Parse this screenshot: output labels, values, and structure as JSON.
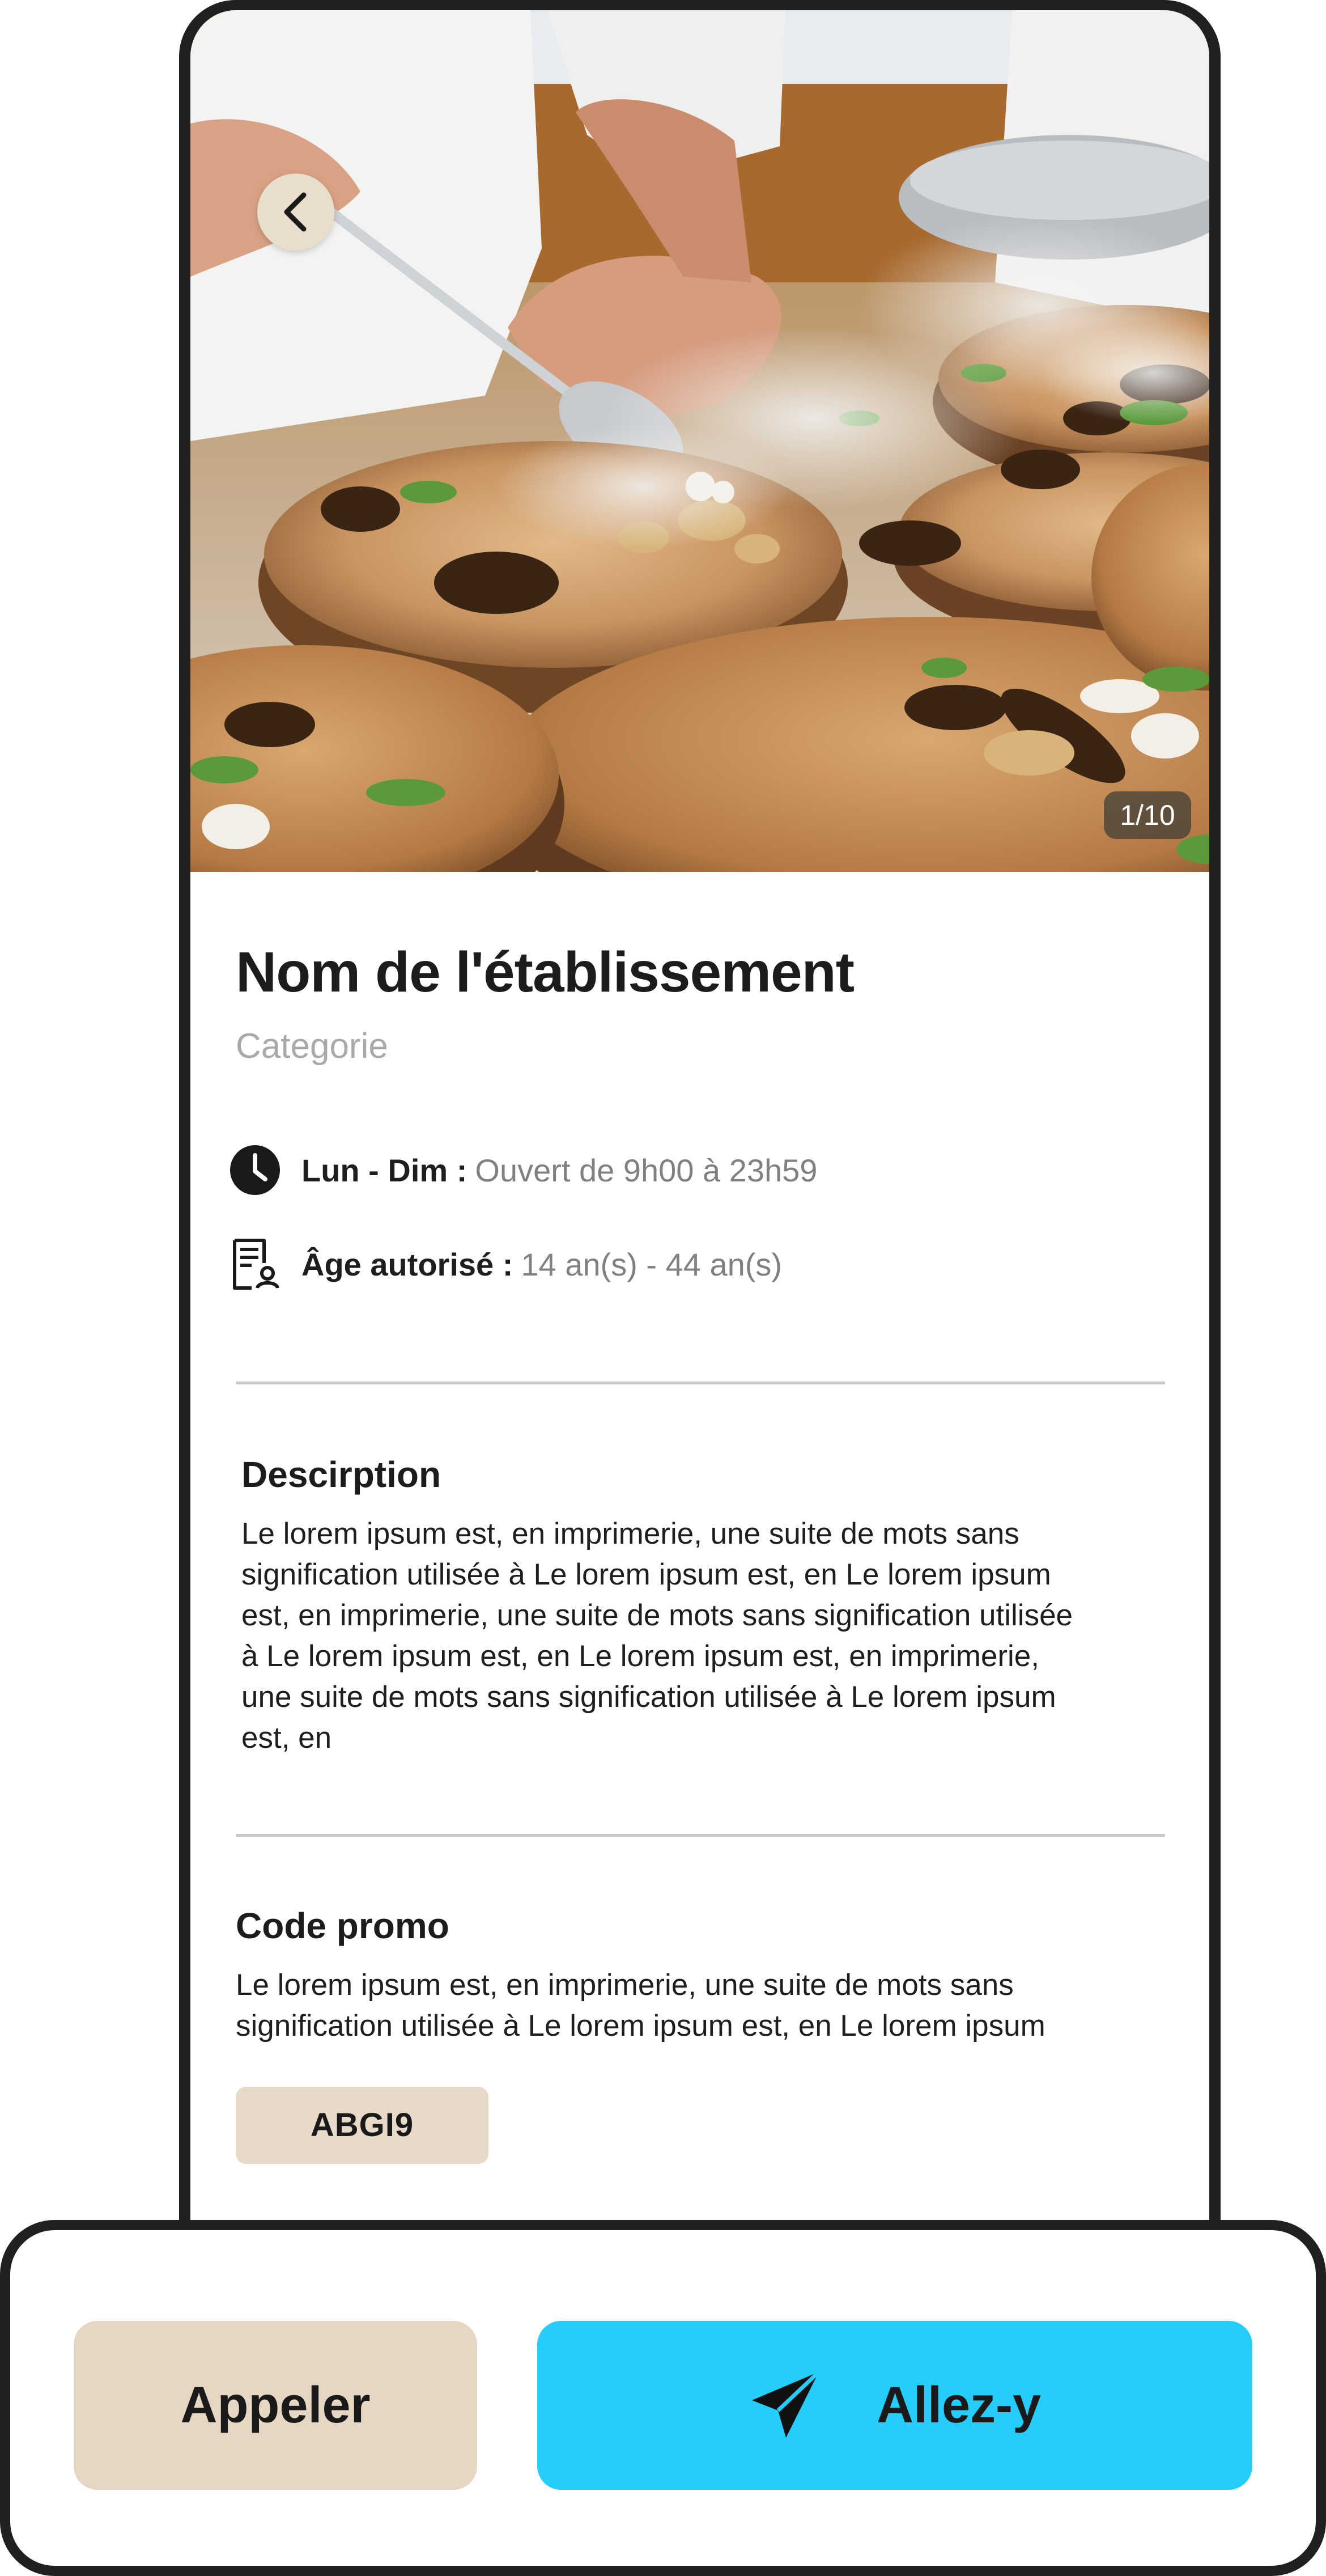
{
  "hero": {
    "counter": "1/10",
    "back_icon": "chevron-left-icon"
  },
  "place": {
    "name": "Nom de l'établissement",
    "category": "Categorie"
  },
  "info": {
    "hours_label": "Lun - Dim :",
    "hours_value": "Ouvert de 9h00 à 23h59",
    "hours_icon": "clock-icon",
    "age_label": "Âge autorisé :",
    "age_value": "14 an(s) - 44 an(s)",
    "age_icon": "id-document-icon"
  },
  "description": {
    "title": "Descirption",
    "lines": [
      "Le lorem ipsum est, en imprimerie, une suite de mots sans",
      "signification utilisée à Le lorem ipsum est, en Le lorem ipsum",
      "est, en imprimerie, une suite de mots sans signification utilisée",
      "à Le lorem ipsum est, en Le lorem ipsum est, en imprimerie,",
      "une suite de mots sans signification utilisée à Le lorem ipsum",
      "est, en"
    ]
  },
  "promo": {
    "title": "Code promo",
    "lines": [
      "Le lorem ipsum est, en imprimerie, une suite de mots sans",
      "signification utilisée à Le lorem ipsum est, en Le lorem ipsum"
    ],
    "code": "ABGI9"
  },
  "actions": {
    "call_label": "Appeler",
    "go_label": "Allez-y",
    "go_icon": "paper-plane-icon"
  },
  "colors": {
    "accent_blue": "#24cdfa",
    "beige": "#e5d7c3",
    "text_dark": "#1c1c1c",
    "text_muted": "#808080"
  }
}
